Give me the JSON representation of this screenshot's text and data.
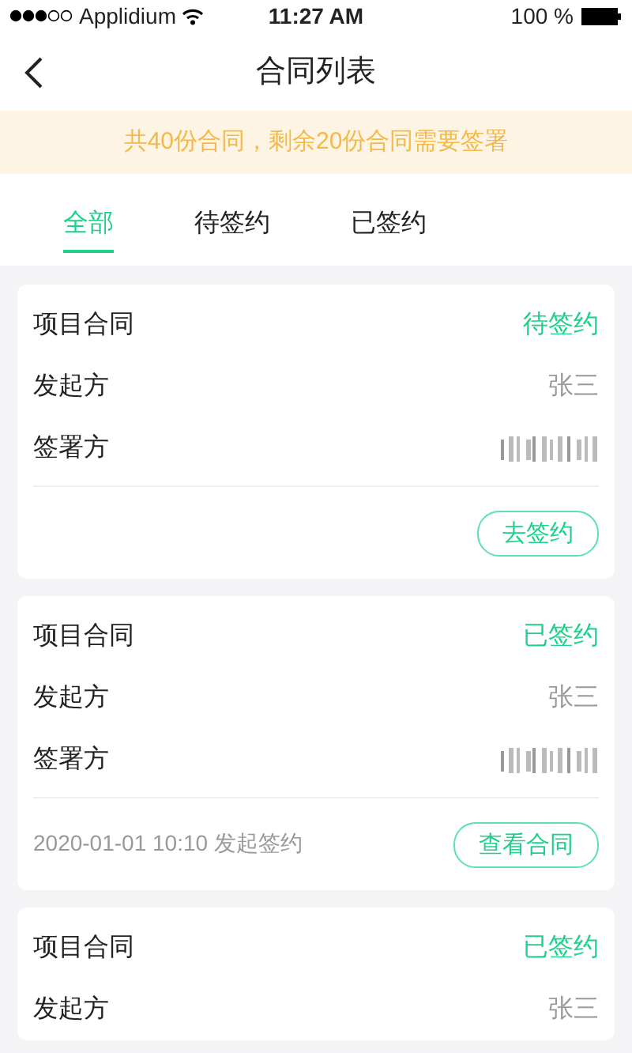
{
  "status_bar": {
    "carrier": "Applidium",
    "time": "11:27 AM",
    "battery": "100 %"
  },
  "nav": {
    "title": "合同列表"
  },
  "notice": "共40份合同，剩余20份合同需要签署",
  "tabs": [
    {
      "label": "全部",
      "selected": true
    },
    {
      "label": "待签约",
      "selected": false
    },
    {
      "label": "已签约",
      "selected": false
    }
  ],
  "contracts": [
    {
      "title": "项目合同",
      "status": "待签约",
      "initiator_label": "发起方",
      "initiator": "张三",
      "signer_label": "签署方",
      "footer": {
        "button": "去签约"
      }
    },
    {
      "title": "项目合同",
      "status": "已签约",
      "initiator_label": "发起方",
      "initiator": "张三",
      "signer_label": "签署方",
      "footer": {
        "note": "2020-01-01 10:10 发起签约",
        "button": "查看合同"
      }
    },
    {
      "title": "项目合同",
      "status": "已签约",
      "initiator_label": "发起方",
      "initiator": "张三"
    }
  ]
}
